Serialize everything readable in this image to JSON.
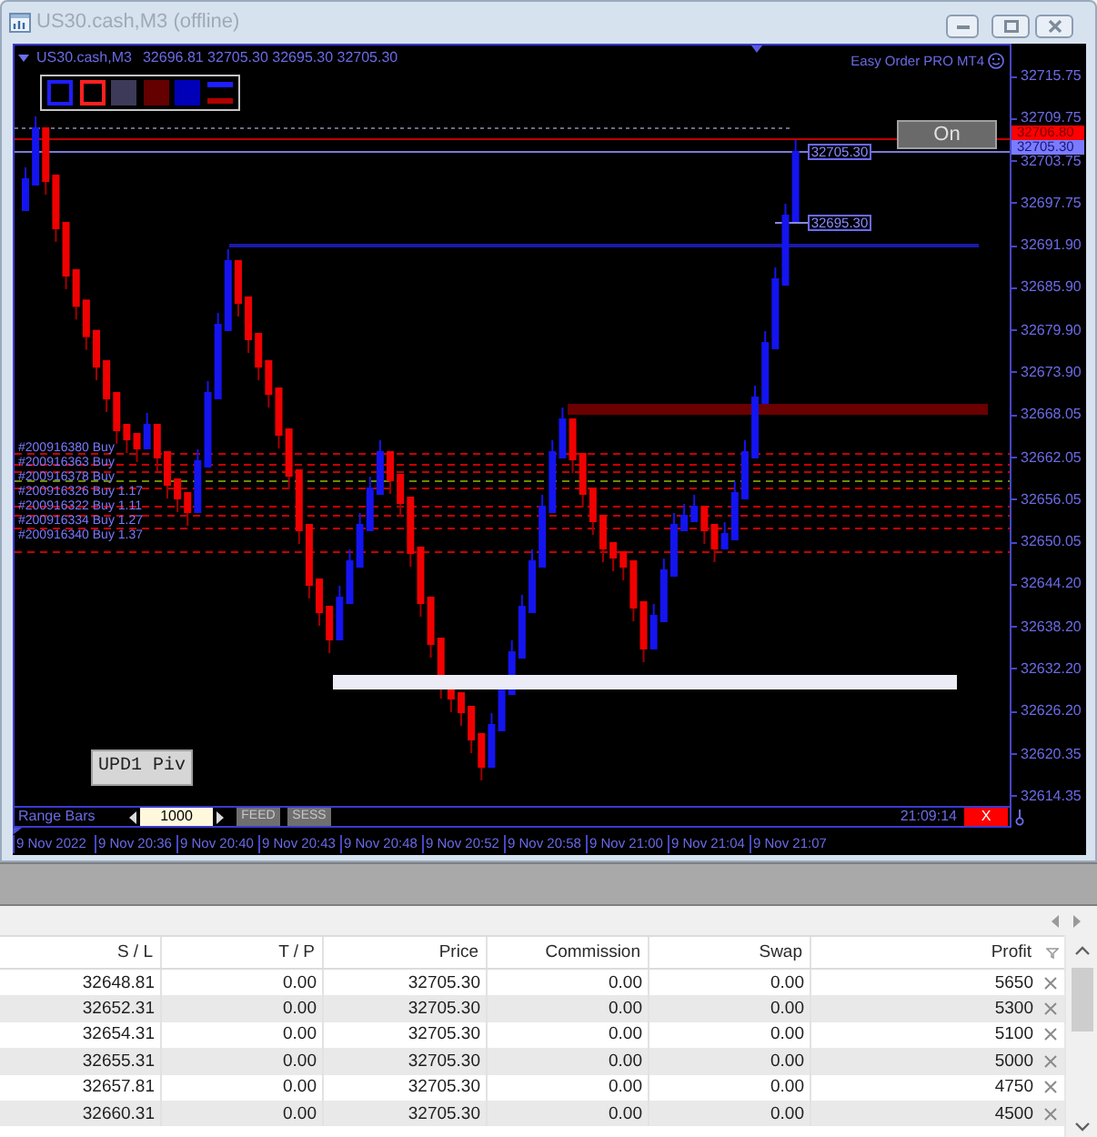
{
  "window": {
    "title": "US30.cash,M3 (offline)"
  },
  "chart": {
    "symbol": "US30.cash,M3",
    "ohlc": "32696.81 32705.30 32695.30 32705.30",
    "tools": [
      {
        "kind": "outline",
        "color": "#1e1eff"
      },
      {
        "kind": "outline",
        "color": "#ff2020"
      },
      {
        "kind": "fill",
        "color": "#3c3a58"
      },
      {
        "kind": "fill",
        "color": "#640000"
      },
      {
        "kind": "fill",
        "color": "#0000b8"
      },
      {
        "kind": "split",
        "color": "#1e1eff"
      }
    ],
    "indicator": "Easy Order PRO MT4",
    "toggle": "On",
    "price_tags": [
      "32705.30",
      "32695.30"
    ],
    "orders": [
      "#200916380 Buy",
      "#200916363 Buy",
      "#200916378 Buy",
      "#200916326 Buy 1.17",
      "#200916322 Buy 1.11",
      "#200916334 Buy 1.27",
      "#200916340 Buy 1.37"
    ],
    "button": "UPD1 Piv"
  },
  "price_axis": {
    "labels": [
      "32715.75",
      "32709.75",
      "32703.75",
      "32697.75",
      "32691.90",
      "32685.90",
      "32679.90",
      "32673.90",
      "32668.05",
      "32662.05",
      "32656.05",
      "32650.05",
      "32644.20",
      "32638.20",
      "32632.20",
      "32626.20",
      "32620.35",
      "32614.35"
    ],
    "ask": "32706.80",
    "bid": "32705.30"
  },
  "status_bar": {
    "mode": "Range Bars",
    "bars": "1000",
    "buttons": [
      "FEED",
      "SESS"
    ],
    "time": "21:09:14",
    "close": "X"
  },
  "time_axis": {
    "labels": [
      "9 Nov 2022",
      "9 Nov 20:36",
      "9 Nov 20:40",
      "9 Nov 20:43",
      "9 Nov 20:48",
      "9 Nov 20:52",
      "9 Nov 20:58",
      "9 Nov 21:00",
      "9 Nov 21:04",
      "9 Nov 21:07"
    ]
  },
  "table": {
    "columns": [
      "S / L",
      "T / P",
      "Price",
      "Commission",
      "Swap",
      "Profit"
    ],
    "rows": [
      [
        "32648.81",
        "0.00",
        "32705.30",
        "0.00",
        "0.00",
        "5650"
      ],
      [
        "32652.31",
        "0.00",
        "32705.30",
        "0.00",
        "0.00",
        "5300"
      ],
      [
        "32654.31",
        "0.00",
        "32705.30",
        "0.00",
        "0.00",
        "5100"
      ],
      [
        "32655.31",
        "0.00",
        "32705.30",
        "0.00",
        "0.00",
        "5000"
      ],
      [
        "32657.81",
        "0.00",
        "32705.30",
        "0.00",
        "0.00",
        "4750"
      ],
      [
        "32660.31",
        "0.00",
        "32705.30",
        "0.00",
        "0.00",
        "4500"
      ]
    ]
  }
}
